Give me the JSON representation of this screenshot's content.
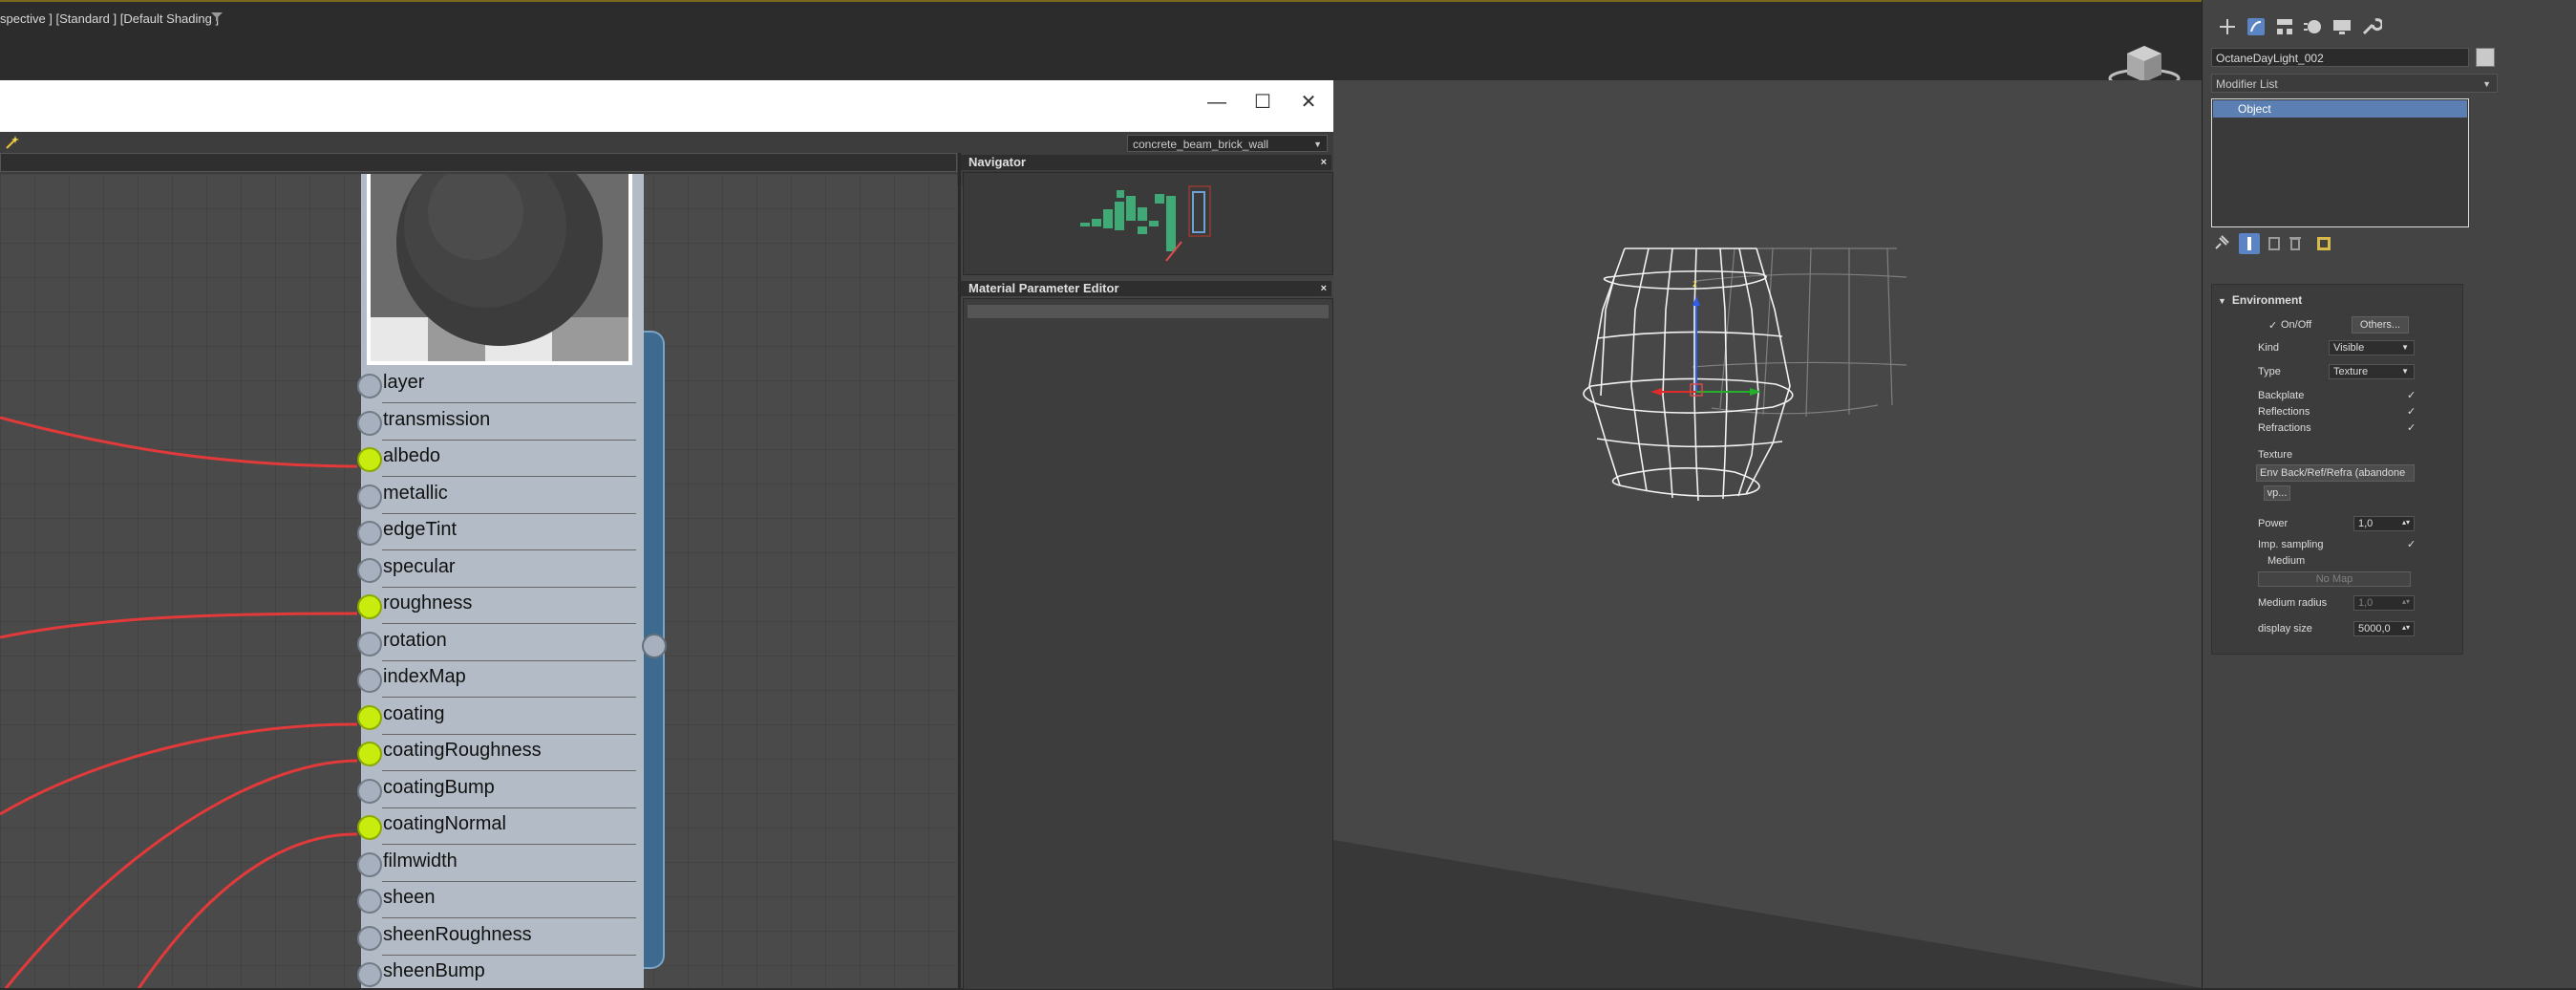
{
  "viewport": {
    "label": "spective ] [Standard ] [Default Shading ]"
  },
  "slate": {
    "window_buttons": {
      "minimize": "—",
      "maximize": "☐",
      "close": "✕"
    },
    "material_dropdown": "concrete_beam_brick_wall",
    "node_slots": [
      {
        "label": "layer",
        "connected": false
      },
      {
        "label": "transmission",
        "connected": false
      },
      {
        "label": "albedo",
        "connected": true
      },
      {
        "label": "metallic",
        "connected": false
      },
      {
        "label": "edgeTint",
        "connected": false
      },
      {
        "label": "specular",
        "connected": false
      },
      {
        "label": "roughness",
        "connected": true
      },
      {
        "label": "rotation",
        "connected": false
      },
      {
        "label": "indexMap",
        "connected": false
      },
      {
        "label": "coating",
        "connected": true
      },
      {
        "label": "coatingRoughness",
        "connected": true
      },
      {
        "label": "coatingBump",
        "connected": false
      },
      {
        "label": "coatingNormal",
        "connected": true
      },
      {
        "label": "filmwidth",
        "connected": false
      },
      {
        "label": "sheen",
        "connected": false
      },
      {
        "label": "sheenRoughness",
        "connected": false
      },
      {
        "label": "sheenBump",
        "connected": false
      }
    ],
    "navigator_title": "Navigator",
    "navigator_close": "×",
    "mpe_title": "Material Parameter Editor",
    "mpe_close": "×",
    "colors": {
      "socket_on": "#c7ec0e",
      "wire": "#e23a3a",
      "node_body": "#b3bcc6"
    }
  },
  "command_panel": {
    "object_name": "OctaneDayLight_002",
    "modifier_list": "Modifier List",
    "stack_item": "Object",
    "rollout": {
      "title": "Environment",
      "on_off_label": "On/Off",
      "on_off_checked": "✓",
      "others_button": "Others...",
      "kind_label": "Kind",
      "kind_value": "Visible",
      "type_label": "Type",
      "type_value": "Texture",
      "backplate_label": "Backplate",
      "reflections_label": "Reflections",
      "refractions_label": "Refractions",
      "check_mark": "✓",
      "texture_label": "Texture",
      "texture_value": "Env Back/Ref/Refra (abandone",
      "vp_button": "vp...",
      "power_label": "Power",
      "power_value": "1,0",
      "imp_sampling_label": "Imp. sampling",
      "medium_label": "Medium",
      "no_map_button": "No Map",
      "medium_radius_label": "Medium radius",
      "medium_radius_value": "1,0",
      "display_size_label": "display size",
      "display_size_value": "5000,0",
      "spinner_arrow": "▴▾"
    }
  },
  "icons": [
    "filter-icon",
    "viewcube-icon",
    "wand-icon",
    "create-tab-icon",
    "modify-tab-icon",
    "hierarchy-tab-icon",
    "motion-tab-icon",
    "display-tab-icon",
    "utilities-tab-icon",
    "pin-stack-icon",
    "show-end-result-icon",
    "make-unique-icon",
    "remove-modifier-icon",
    "configure-sets-icon"
  ]
}
